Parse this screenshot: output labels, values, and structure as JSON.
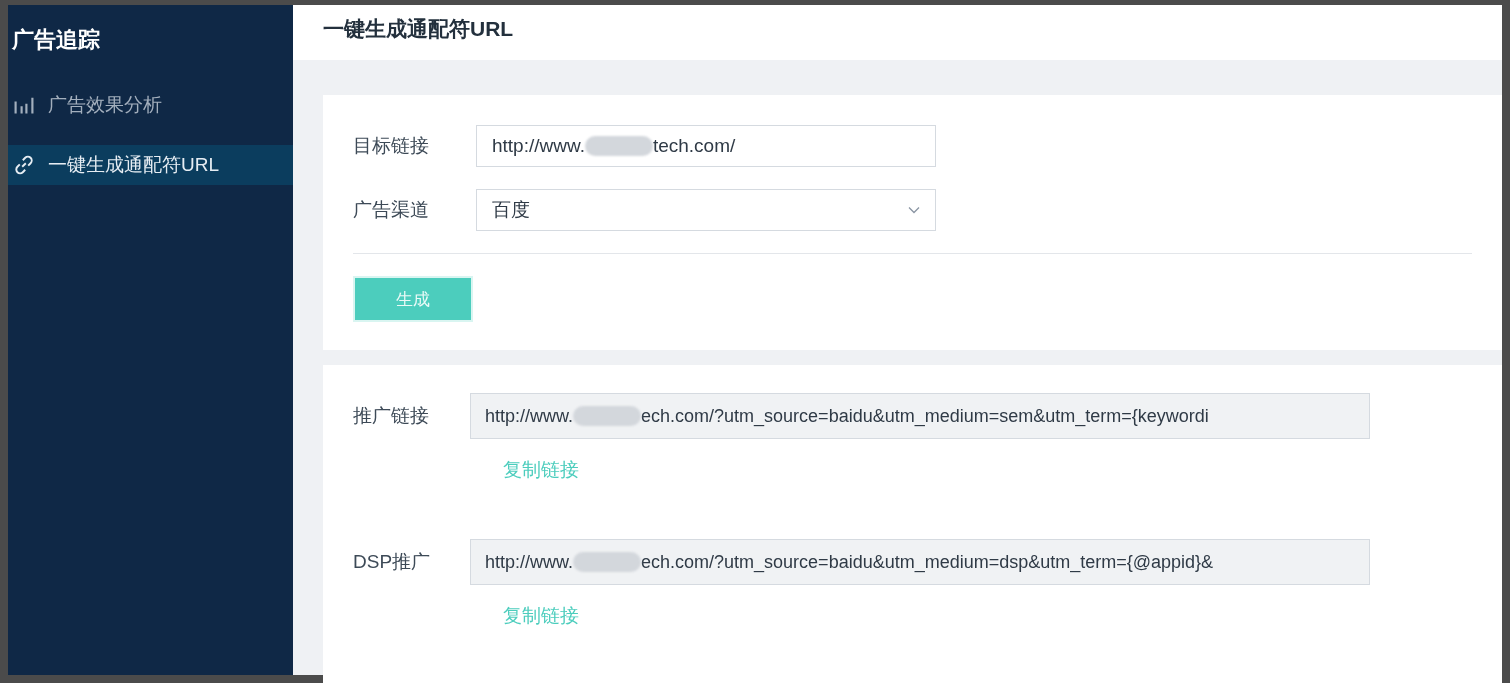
{
  "sidebar": {
    "title": "广告追踪",
    "items": [
      {
        "label": "广告效果分析",
        "kind": "chart",
        "selected": false
      },
      {
        "label": "一键生成通配符URL",
        "kind": "link",
        "selected": true
      }
    ]
  },
  "page_title": "一键生成通配符URL",
  "form": {
    "fields": [
      {
        "label": "目标链接",
        "kind": "input",
        "value_before": "http://www.",
        "value_after": "tech.com/"
      },
      {
        "label": "广告渠道",
        "kind": "select",
        "value": "百度"
      }
    ],
    "button": "生成"
  },
  "results": [
    {
      "label": "推广链接",
      "value_before": "http://www.",
      "value_after": "ech.com/?utm_source=baidu&utm_medium=sem&utm_term={keywordi",
      "copy_link": "复制链接"
    },
    {
      "label": "DSP推广",
      "value_before": "http://www.",
      "value_after": "ech.com/?utm_source=baidu&utm_medium=dsp&utm_term={@appid}&",
      "copy_link": "复制链接"
    }
  ]
}
